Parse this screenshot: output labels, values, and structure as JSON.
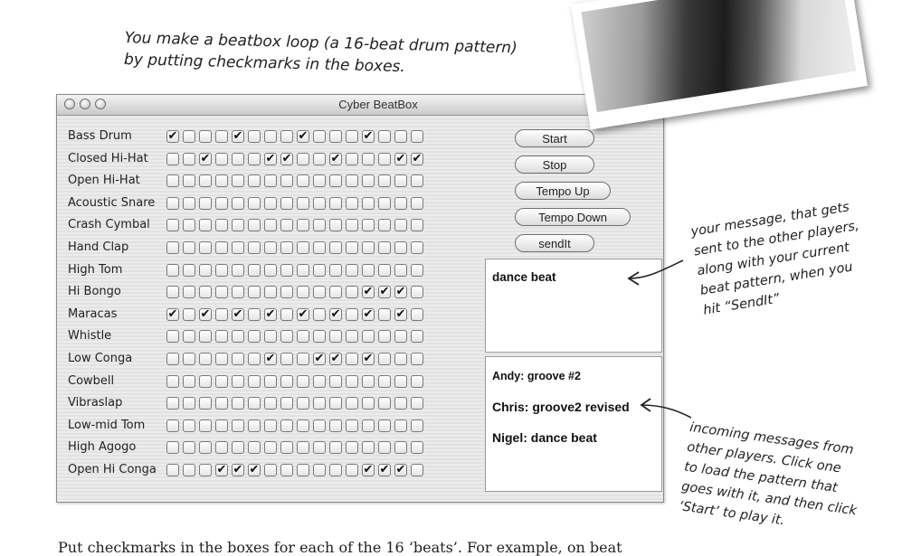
{
  "annotations": {
    "top_line1": "You make a beatbox loop (a 16-beat drum pattern)",
    "top_line2": "by putting checkmarks in the boxes.",
    "right_lines": [
      "your message, that gets",
      "sent to the other players,",
      "along with your current",
      "beat pattern, when you",
      "hit “SendIt”"
    ],
    "bottom_lines": [
      "incoming messages from",
      "other players. Click one",
      "to load the pattern that",
      "goes with it, and then click",
      "‘Start’ to play it."
    ],
    "caption": "Put checkmarks in the boxes for each of the 16 ‘beats’. For example, on beat"
  },
  "window": {
    "title": "Cyber BeatBox"
  },
  "instruments": [
    {
      "label": "Bass Drum",
      "beats": [
        1,
        0,
        0,
        0,
        1,
        0,
        0,
        0,
        1,
        0,
        0,
        0,
        1,
        0,
        0,
        0
      ]
    },
    {
      "label": "Closed Hi-Hat",
      "beats": [
        0,
        0,
        1,
        0,
        0,
        0,
        1,
        1,
        0,
        0,
        1,
        0,
        0,
        0,
        1,
        1
      ]
    },
    {
      "label": "Open Hi-Hat",
      "beats": [
        0,
        0,
        0,
        0,
        0,
        0,
        0,
        0,
        0,
        0,
        0,
        0,
        0,
        0,
        0,
        0
      ]
    },
    {
      "label": "Acoustic Snare",
      "beats": [
        0,
        0,
        0,
        0,
        0,
        0,
        0,
        0,
        0,
        0,
        0,
        0,
        0,
        0,
        0,
        0
      ]
    },
    {
      "label": "Crash Cymbal",
      "beats": [
        0,
        0,
        0,
        0,
        0,
        0,
        0,
        0,
        0,
        0,
        0,
        0,
        0,
        0,
        0,
        0
      ]
    },
    {
      "label": "Hand Clap",
      "beats": [
        0,
        0,
        0,
        0,
        0,
        0,
        0,
        0,
        0,
        0,
        0,
        0,
        0,
        0,
        0,
        0
      ]
    },
    {
      "label": "High Tom",
      "beats": [
        0,
        0,
        0,
        0,
        0,
        0,
        0,
        0,
        0,
        0,
        0,
        0,
        0,
        0,
        0,
        0
      ]
    },
    {
      "label": "Hi Bongo",
      "beats": [
        0,
        0,
        0,
        0,
        0,
        0,
        0,
        0,
        0,
        0,
        0,
        0,
        1,
        1,
        1,
        0
      ]
    },
    {
      "label": "Maracas",
      "beats": [
        1,
        0,
        1,
        0,
        1,
        0,
        1,
        0,
        1,
        0,
        1,
        0,
        1,
        0,
        1,
        0
      ]
    },
    {
      "label": "Whistle",
      "beats": [
        0,
        0,
        0,
        0,
        0,
        0,
        0,
        0,
        0,
        0,
        0,
        0,
        0,
        0,
        0,
        0
      ]
    },
    {
      "label": "Low Conga",
      "beats": [
        0,
        0,
        0,
        0,
        0,
        0,
        1,
        0,
        0,
        1,
        1,
        0,
        1,
        0,
        0,
        0
      ]
    },
    {
      "label": "Cowbell",
      "beats": [
        0,
        0,
        0,
        0,
        0,
        0,
        0,
        0,
        0,
        0,
        0,
        0,
        0,
        0,
        0,
        0
      ]
    },
    {
      "label": "Vibraslap",
      "beats": [
        0,
        0,
        0,
        0,
        0,
        0,
        0,
        0,
        0,
        0,
        0,
        0,
        0,
        0,
        0,
        0
      ]
    },
    {
      "label": "Low-mid Tom",
      "beats": [
        0,
        0,
        0,
        0,
        0,
        0,
        0,
        0,
        0,
        0,
        0,
        0,
        0,
        0,
        0,
        0
      ]
    },
    {
      "label": "High Agogo",
      "beats": [
        0,
        0,
        0,
        0,
        0,
        0,
        0,
        0,
        0,
        0,
        0,
        0,
        0,
        0,
        0,
        0
      ]
    },
    {
      "label": "Open Hi Conga",
      "beats": [
        0,
        0,
        0,
        1,
        1,
        1,
        0,
        0,
        0,
        0,
        0,
        0,
        1,
        1,
        1,
        0
      ]
    }
  ],
  "check_glyph": "✔",
  "buttons": {
    "start": "Start",
    "stop": "Stop",
    "tempo_up": "Tempo Up",
    "tempo_down": "Tempo Down",
    "send_it": "sendIt"
  },
  "message": {
    "text": "dance beat"
  },
  "incoming": [
    "Andy: groove #2",
    "Chris: groove2 revised",
    "Nigel: dance beat"
  ]
}
